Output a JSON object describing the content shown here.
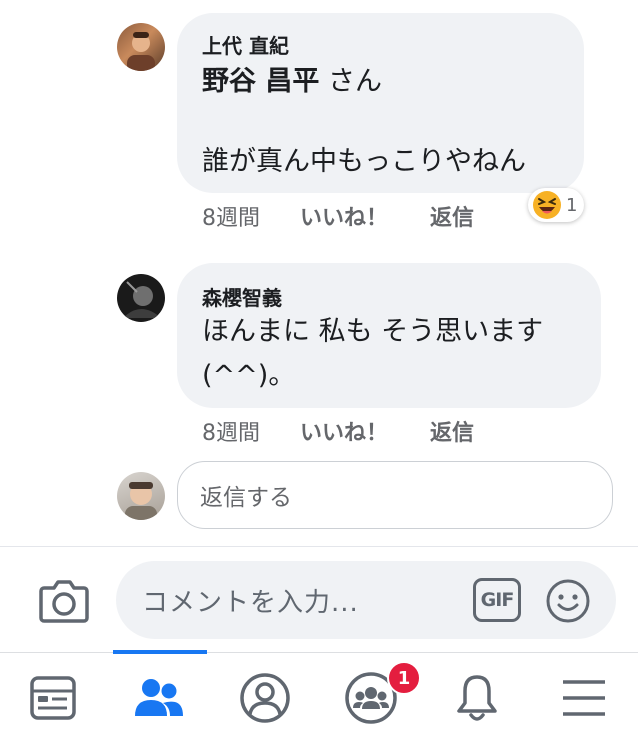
{
  "comments": [
    {
      "author": "上代 直紀",
      "mention": "野谷 昌平",
      "mention_suffix": " さん",
      "text": "誰が真ん中もっこりやねん",
      "time": "8週間",
      "like_label": "いいね！",
      "reply_label": "返信",
      "reaction": {
        "emoji": "laughing",
        "count": "1"
      }
    },
    {
      "author": "森櫻智義",
      "text_line1": "ほんまに 私も そう思います",
      "text_line2": "(^^)。",
      "time": "8週間",
      "like_label": "いいね！",
      "reply_label": "返信"
    }
  ],
  "reply_box": {
    "placeholder": "返信する"
  },
  "composer": {
    "placeholder": "コメントを入力...",
    "gif_label": "GIF"
  },
  "bottom_nav": {
    "items": [
      "news-feed",
      "friends",
      "profile",
      "groups",
      "notifications",
      "menu"
    ],
    "active": "friends",
    "groups_badge": "1",
    "accent": "#1877f2",
    "icon_color": "#606770"
  }
}
